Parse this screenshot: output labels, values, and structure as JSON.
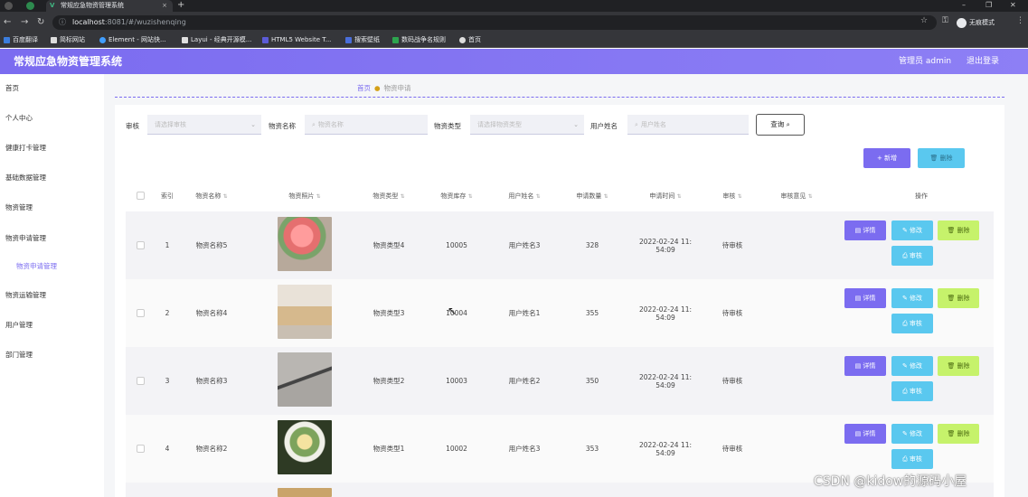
{
  "browser": {
    "tab_title": "常规应急物资管理系统",
    "url_host": "localhost",
    "url_rest": ":8081/#/wuzishenqing",
    "profile_label": "无痕模式",
    "bookmarks": [
      "百度翻译",
      "简标网站",
      "Element - 网站快...",
      "Layui - 经典开源模...",
      "HTML5 Website T...",
      "搜索壁纸",
      "数码战争名规则",
      "首页"
    ]
  },
  "header": {
    "title": "常规应急物资管理系统",
    "admin": "管理员 admin",
    "logout": "退出登录"
  },
  "sidebar": {
    "items": [
      "首页",
      "个人中心",
      "健康打卡管理",
      "基础数据管理",
      "物资管理",
      "物资申请管理",
      "物资申请管理",
      "物资运输管理",
      "用户管理",
      "部门管理"
    ]
  },
  "breadcrumb": {
    "home": "首页",
    "current": "物资申请"
  },
  "filters": {
    "audit_label": "审核",
    "audit_placeholder": "请选择审核",
    "name_label": "物资名称",
    "name_placeholder": "物资名称",
    "type_label": "物资类型",
    "type_placeholder": "请选择物资类型",
    "user_label": "用户姓名",
    "user_placeholder": "用户姓名",
    "query": "查询"
  },
  "actions": {
    "add": "+ 新增",
    "delete": "删除"
  },
  "table": {
    "headers": [
      "索引",
      "物资名称",
      "物资照片",
      "物资类型",
      "物资库存",
      "用户姓名",
      "申请数量",
      "申请时间",
      "审核",
      "审核意见",
      "操作"
    ],
    "rows": [
      {
        "index": "1",
        "name": "物资名称5",
        "type": "物资类型4",
        "stock": "10005",
        "user": "用户姓名3",
        "qty": "328",
        "time1": "2022-02-24 11:",
        "time2": "54:09",
        "audit": "待审核",
        "opinion": ""
      },
      {
        "index": "2",
        "name": "物资名称4",
        "type": "物资类型3",
        "stock": "10004",
        "user": "用户姓名1",
        "qty": "355",
        "time1": "2022-02-24 11:",
        "time2": "54:09",
        "audit": "待审核",
        "opinion": ""
      },
      {
        "index": "3",
        "name": "物资名称3",
        "type": "物资类型2",
        "stock": "10003",
        "user": "用户姓名2",
        "qty": "350",
        "time1": "2022-02-24 11:",
        "time2": "54:09",
        "audit": "待审核",
        "opinion": ""
      },
      {
        "index": "4",
        "name": "物资名称2",
        "type": "物资类型1",
        "stock": "10002",
        "user": "用户姓名3",
        "qty": "353",
        "time1": "2022-02-24 11:",
        "time2": "54:09",
        "audit": "待审核",
        "opinion": ""
      }
    ],
    "row_buttons": {
      "detail": "详情",
      "edit": "修改",
      "delete": "删除",
      "audit": "审核"
    }
  },
  "watermark": "CSDN @kidow的源码小屋",
  "colors": {
    "accent": "#7b6cf0",
    "cyan": "#5ac8ef",
    "lime": "#c6f26b"
  }
}
